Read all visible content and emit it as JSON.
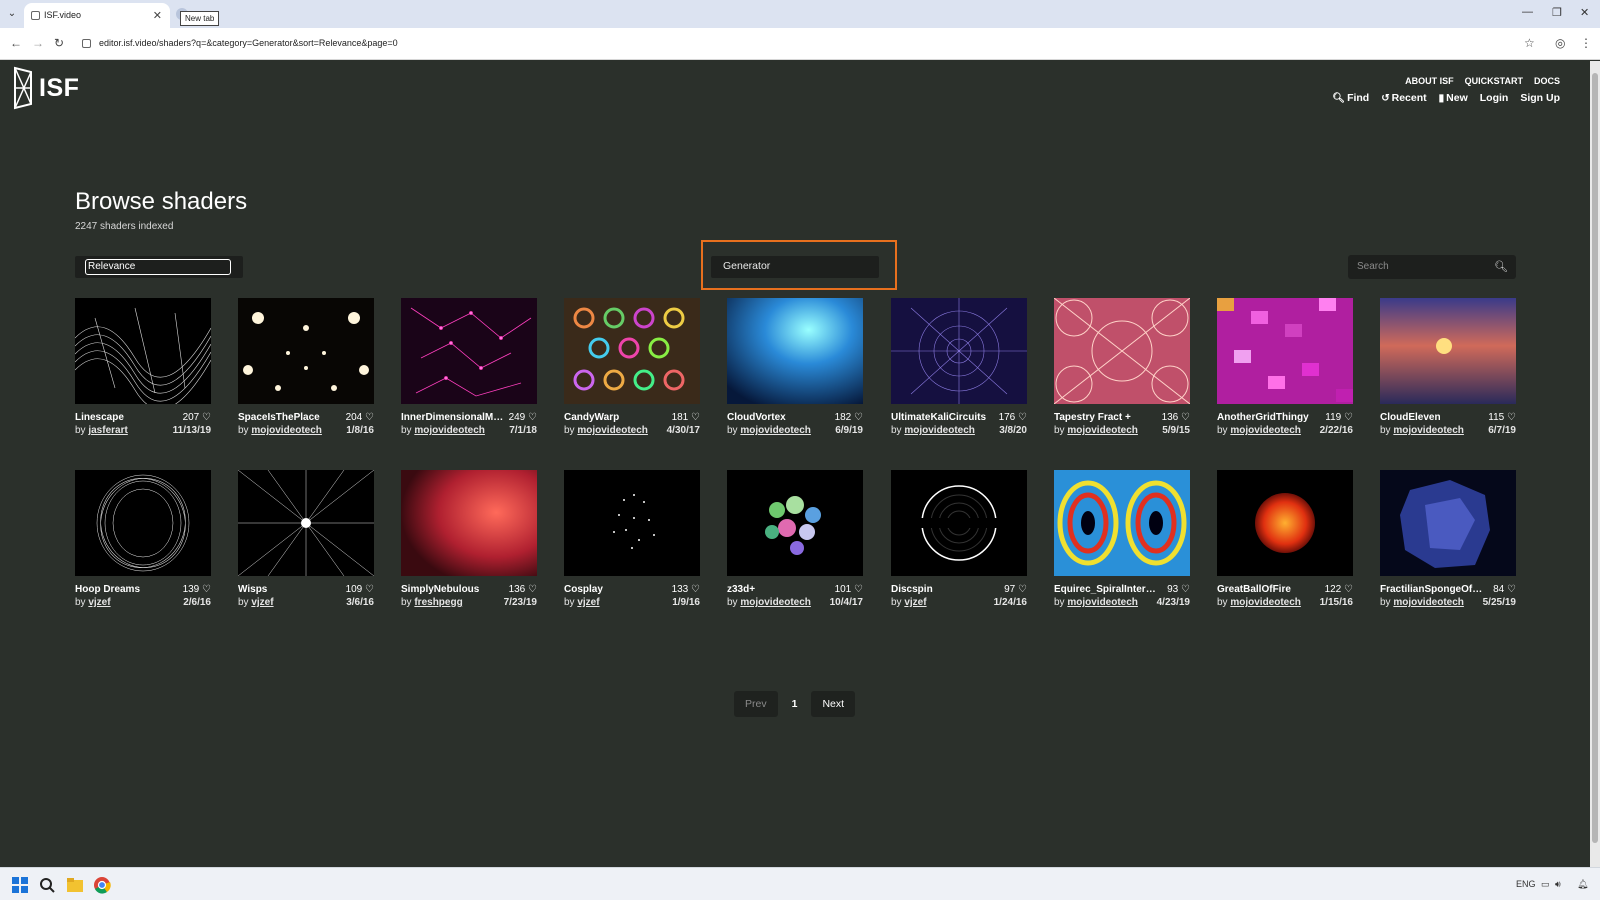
{
  "browser": {
    "tab_title": "ISF.video",
    "tooltip": "New tab",
    "url": "editor.isf.video/shaders?q=&category=Generator&sort=Relevance&page=0"
  },
  "header": {
    "logo_text": "ISF",
    "top_links": [
      "ABOUT ISF",
      "QUICKSTART",
      "DOCS"
    ],
    "main_links": {
      "find": "Find",
      "recent": "Recent",
      "new": "New",
      "login": "Login",
      "signup": "Sign Up"
    }
  },
  "main": {
    "title": "Browse shaders",
    "subtitle": "2247 shaders indexed",
    "sort_value": "Relevance",
    "category_value": "Generator",
    "search_placeholder": "Search"
  },
  "shaders": [
    {
      "name": "Linescape",
      "likes": "207",
      "author": "jasferart",
      "date": "11/13/19"
    },
    {
      "name": "SpaceIsThePlace",
      "likes": "204",
      "author": "mojovideotech",
      "date": "1/8/16"
    },
    {
      "name": "InnerDimensionalMat...",
      "likes": "249",
      "author": "mojovideotech",
      "date": "7/1/18"
    },
    {
      "name": "CandyWarp",
      "likes": "181",
      "author": "mojovideotech",
      "date": "4/30/17"
    },
    {
      "name": "CloudVortex",
      "likes": "182",
      "author": "mojovideotech",
      "date": "6/9/19"
    },
    {
      "name": "UltimateKaliCircuits",
      "likes": "176",
      "author": "mojovideotech",
      "date": "3/8/20"
    },
    {
      "name": "Tapestry Fract +",
      "likes": "136",
      "author": "mojovideotech",
      "date": "5/9/15"
    },
    {
      "name": "AnotherGridThingy",
      "likes": "119",
      "author": "mojovideotech",
      "date": "2/22/16"
    },
    {
      "name": "CloudEleven",
      "likes": "115",
      "author": "mojovideotech",
      "date": "6/7/19"
    },
    {
      "name": "Hoop Dreams",
      "likes": "139",
      "author": "vjzef",
      "date": "2/6/16"
    },
    {
      "name": "Wisps",
      "likes": "109",
      "author": "vjzef",
      "date": "3/6/16"
    },
    {
      "name": "SimplyNebulous",
      "likes": "136",
      "author": "freshpegg",
      "date": "7/23/19"
    },
    {
      "name": "Cosplay",
      "likes": "133",
      "author": "vjzef",
      "date": "1/9/16"
    },
    {
      "name": "z33d+",
      "likes": "101",
      "author": "mojovideotech",
      "date": "10/4/17"
    },
    {
      "name": "Discspin",
      "likes": "97",
      "author": "vjzef",
      "date": "1/24/16"
    },
    {
      "name": "Equirec_SpiralInters...",
      "likes": "93",
      "author": "mojovideotech",
      "date": "4/23/19"
    },
    {
      "name": "GreatBallOfFire",
      "likes": "122",
      "author": "mojovideotech",
      "date": "1/15/16"
    },
    {
      "name": "FractilianSpongeOfD...",
      "likes": "84",
      "author": "mojovideotech",
      "date": "5/25/19"
    }
  ],
  "pager": {
    "prev": "Prev",
    "page": "1",
    "next": "Next"
  },
  "taskbar": {
    "lang": "ENG"
  },
  "colors": {
    "page_bg": "#2b302b",
    "highlight": "#e8701e"
  }
}
